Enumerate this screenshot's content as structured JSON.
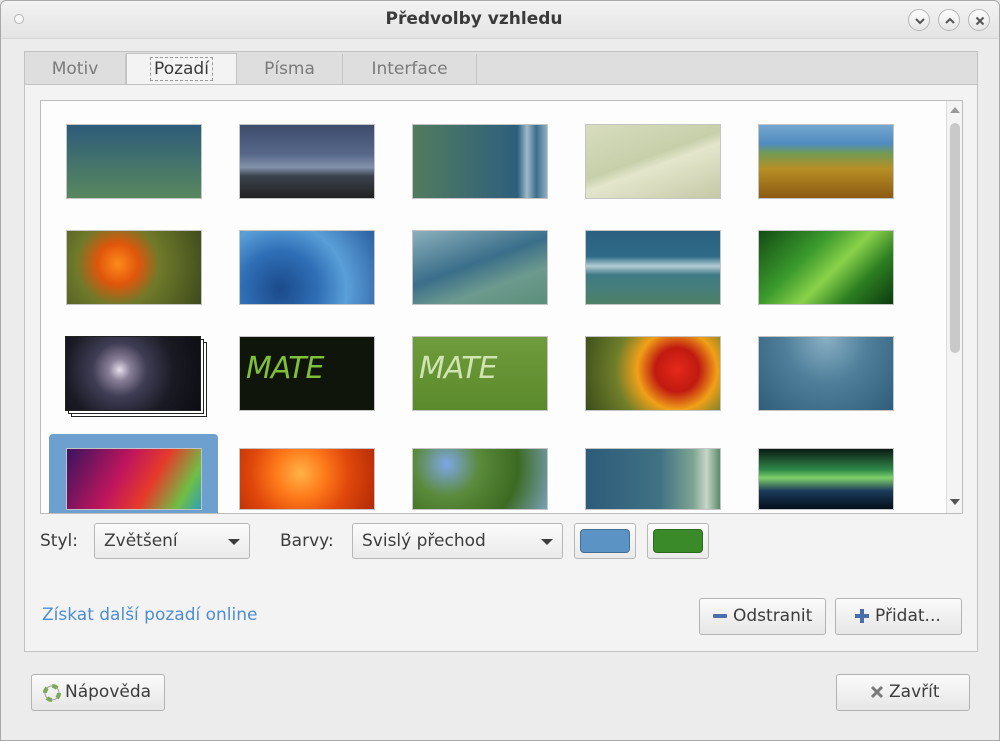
{
  "window": {
    "title": "Předvolby vzhledu"
  },
  "tabs": [
    {
      "label": "Motiv"
    },
    {
      "label": "Pozadí"
    },
    {
      "label": "Písma"
    },
    {
      "label": "Interface"
    }
  ],
  "background_tab": {
    "wallpapers": [
      {
        "name": "blue-green-gradient"
      },
      {
        "name": "storm-clouds"
      },
      {
        "name": "green-blue-waves-right"
      },
      {
        "name": "pale-fabric"
      },
      {
        "name": "dry-grass-sea"
      },
      {
        "name": "orange-flower-dandelion"
      },
      {
        "name": "blue-bubbles"
      },
      {
        "name": "soft-teal-waves"
      },
      {
        "name": "blue-wave-ribbon"
      },
      {
        "name": "green-leaves-droplets"
      },
      {
        "name": "spiral-galaxy-slideshow"
      },
      {
        "name": "mate-dark-logo"
      },
      {
        "name": "mate-green-logo"
      },
      {
        "name": "red-marigold"
      },
      {
        "name": "teal-abstract"
      },
      {
        "name": "rainbow-gradient"
      },
      {
        "name": "orange-petals"
      },
      {
        "name": "forget-me-not"
      },
      {
        "name": "gradient-bubbles"
      },
      {
        "name": "aurora-green"
      }
    ],
    "mate_logo_text": "MATE",
    "style_label": "Styl:",
    "style_value": "Zvětšení",
    "colors_label": "Barvy:",
    "colors_value": "Svislý přechod",
    "primary_color": "#5b93c4",
    "secondary_color": "#3a8a2a",
    "online_link": "Získat další pozadí online",
    "remove_button": "Odstranit",
    "add_button": "Přidat..."
  },
  "footer": {
    "help_button": "Nápověda",
    "close_button": "Zavřít"
  }
}
